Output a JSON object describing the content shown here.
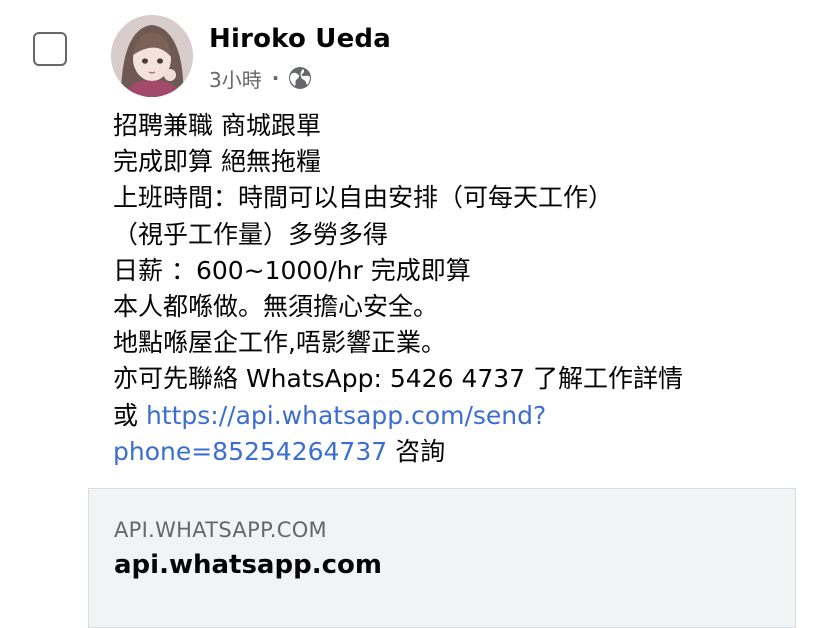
{
  "post": {
    "author": "Hiroko Ueda",
    "timestamp": "3小時",
    "separator": "·",
    "privacy_icon": "globe-icon",
    "lines": [
      "招聘兼職 商城跟單",
      "完成即算 絕無拖糧",
      "上班時間：時間可以自由安排（可每天工作）",
      "（視乎工作量）多勞多得",
      "日薪 ：600~1000/hr 完成即算",
      "本人都喺做。無須擔心安全。",
      "地點喺屋企工作,唔影響正業。",
      "亦可先聯絡 WhatsApp: 5426 4737 了解工作詳情"
    ],
    "link_prefix": "或 ",
    "link_line1": "https://api.whatsapp.com/send?",
    "link_line2": "phone=85254264737",
    "link_suffix": " 咨詢"
  },
  "link_preview": {
    "domain": "API.WHATSAPP.COM",
    "title": "api.whatsapp.com"
  },
  "colors": {
    "link": "#3b6ed0",
    "secondary_text": "#65676b",
    "preview_bg": "#f2f3f5"
  }
}
